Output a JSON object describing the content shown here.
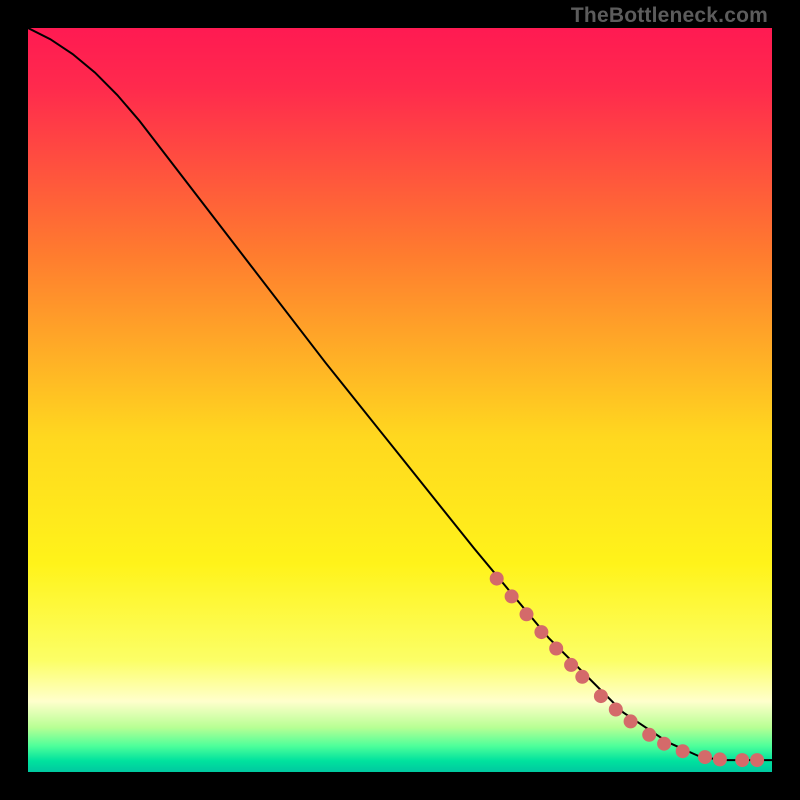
{
  "watermark": "TheBottleneck.com",
  "chart_data": {
    "type": "line",
    "title": "",
    "xlabel": "",
    "ylabel": "",
    "xlim": [
      0,
      100
    ],
    "ylim": [
      0,
      100
    ],
    "background_gradient_stops": [
      {
        "pos": 0.0,
        "color": "#ff1a52"
      },
      {
        "pos": 0.08,
        "color": "#ff2a4d"
      },
      {
        "pos": 0.3,
        "color": "#ff7a2f"
      },
      {
        "pos": 0.55,
        "color": "#ffd81f"
      },
      {
        "pos": 0.72,
        "color": "#fff31a"
      },
      {
        "pos": 0.85,
        "color": "#fcff66"
      },
      {
        "pos": 0.905,
        "color": "#ffffcc"
      },
      {
        "pos": 0.94,
        "color": "#b8ff94"
      },
      {
        "pos": 0.965,
        "color": "#4eff9a"
      },
      {
        "pos": 0.985,
        "color": "#00e29e"
      },
      {
        "pos": 1.0,
        "color": "#00c8a0"
      }
    ],
    "curve": {
      "x": [
        0,
        3,
        6,
        9,
        12,
        15,
        20,
        30,
        40,
        50,
        60,
        70,
        80,
        86,
        90,
        92,
        94,
        96,
        98,
        100
      ],
      "y": [
        100,
        98.5,
        96.5,
        94,
        91,
        87.5,
        81,
        68,
        55,
        42.5,
        30,
        18,
        8,
        4,
        2.2,
        1.8,
        1.6,
        1.6,
        1.6,
        1.6
      ]
    },
    "marker_radius_px": 7,
    "marker_fill": "#d46a6a",
    "marker_stroke": "#7e2e2e",
    "markers": [
      {
        "x": 63,
        "y": 26.0
      },
      {
        "x": 65,
        "y": 23.6
      },
      {
        "x": 67,
        "y": 21.2
      },
      {
        "x": 69,
        "y": 18.8
      },
      {
        "x": 71,
        "y": 16.6
      },
      {
        "x": 73,
        "y": 14.4
      },
      {
        "x": 74.5,
        "y": 12.8
      },
      {
        "x": 77,
        "y": 10.2
      },
      {
        "x": 79,
        "y": 8.4
      },
      {
        "x": 81,
        "y": 6.8
      },
      {
        "x": 83.5,
        "y": 5.0
      },
      {
        "x": 85.5,
        "y": 3.8
      },
      {
        "x": 88,
        "y": 2.8
      },
      {
        "x": 91,
        "y": 2.0
      },
      {
        "x": 93,
        "y": 1.7
      },
      {
        "x": 96,
        "y": 1.6
      },
      {
        "x": 98,
        "y": 1.6
      }
    ]
  }
}
